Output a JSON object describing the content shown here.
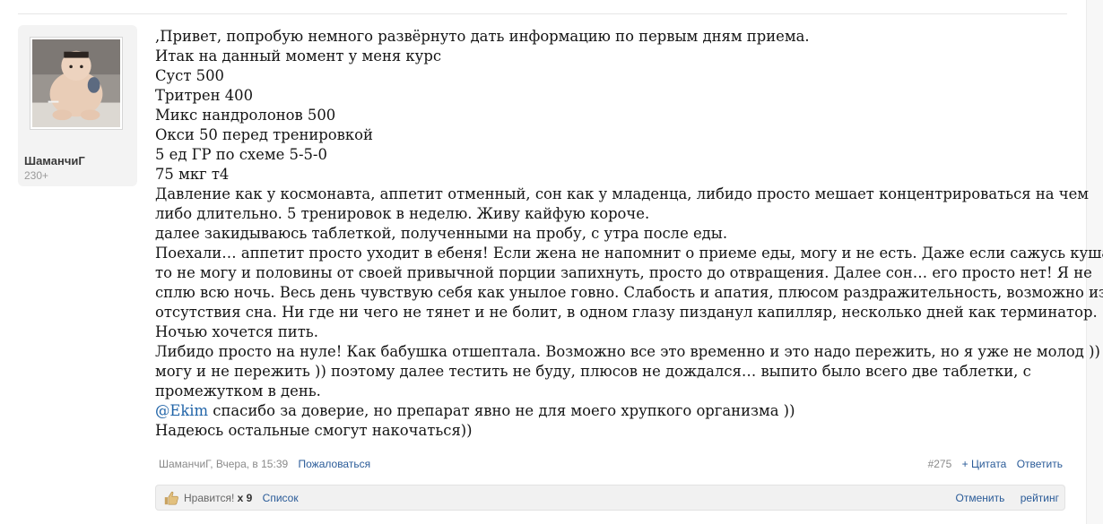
{
  "user": {
    "name": "ШаманчиГ",
    "stat": "230+"
  },
  "message": {
    "lines": [
      ",Привет, попробую немного развёрнуто дать информацию по первым дням приема.",
      "Итак на данный момент у меня курс",
      "Суст 500",
      "Тритрен 400",
      "Микс нандролонов 500",
      "Окси 50 перед тренировкой",
      "5 ед ГР по схеме 5-5-0",
      "75 мкг т4",
      "Давление как у космонавта, аппетит отменный, сон как у младенца, либидо просто мешает концентрироваться на чем",
      "либо длительно. 5 тренировок в неделю. Живу кайфую короче.",
      "далее закидываюсь таблеткой, полученными на пробу, с утра после еды.",
      "Поехали… аппетит просто уходит в ебеня! Если жена не напомнит о приеме еды, могу и не есть. Даже если сажусь кушать,",
      "то не могу и половины от своей привычной порции запихнуть, просто до отвращения. Далее сон… его просто нет! Я не",
      "сплю всю ночь. Весь день чувствую себя как унылое говно. Слабость и апатия, плюсом раздражительность, возможно из за",
      "отсутствия сна. Ни где ни чего не тянет и не болит, в одном глазу пизданул капилляр, несколько дней как терминатор.",
      "Ночью хочется пить.",
      "Либидо просто на нуле! Как бабушка отшептала. Возможно все это временно и это надо пережить, но я уже не молод ))",
      "могу и не пережить )) поэтому далее тестить не буду, плюсов не дождался… выпито было всего две таблетки, с",
      "промежутком в день."
    ],
    "mention": "@Ekim",
    "mention_rest": " спасибо за доверие, но препарат явно не для моего хрупкого организма ))",
    "last_line": "Надеюсь остальные смогут накочаться))"
  },
  "meta": {
    "author_time": "ШаманчиГ, Вчера, в 15:39",
    "report": "Пожаловаться",
    "post_number": "#275",
    "quote": "+ Цитата",
    "reply": "Ответить"
  },
  "likes": {
    "label": "Нравится!",
    "count": "x 9",
    "list": "Список",
    "cancel": "Отменить",
    "rating": "рейтинг"
  },
  "icons": {
    "thumb": "thumbs-up-icon",
    "avatar": "avatar-image"
  },
  "colors": {
    "link": "#2a5b98",
    "mention": "#1f63a7",
    "panel": "#f3f3f3"
  }
}
